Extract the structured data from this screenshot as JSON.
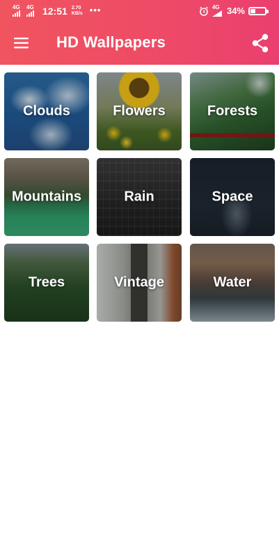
{
  "status_bar": {
    "network_1": "4G",
    "network_2": "4G",
    "time": "12:51",
    "speed_value": "2.70",
    "speed_unit": "KB/s",
    "more_dots": "•••",
    "network_3": "4G",
    "battery_percent": "34%",
    "battery_level": 0.34
  },
  "app_bar": {
    "title": "HD Wallpapers",
    "menu_icon": "hamburger-menu-icon",
    "share_icon": "share-icon"
  },
  "categories": [
    {
      "label": "Clouds"
    },
    {
      "label": "Flowers"
    },
    {
      "label": "Forests"
    },
    {
      "label": "Mountains"
    },
    {
      "label": "Rain"
    },
    {
      "label": "Space"
    },
    {
      "label": "Trees"
    },
    {
      "label": "Vintage"
    },
    {
      "label": "Water"
    }
  ],
  "colors": {
    "app_bar_gradient_start": "#f0545f",
    "app_bar_gradient_end": "#ea3f6f",
    "label_text": "#ffffff",
    "background": "#ffffff"
  }
}
